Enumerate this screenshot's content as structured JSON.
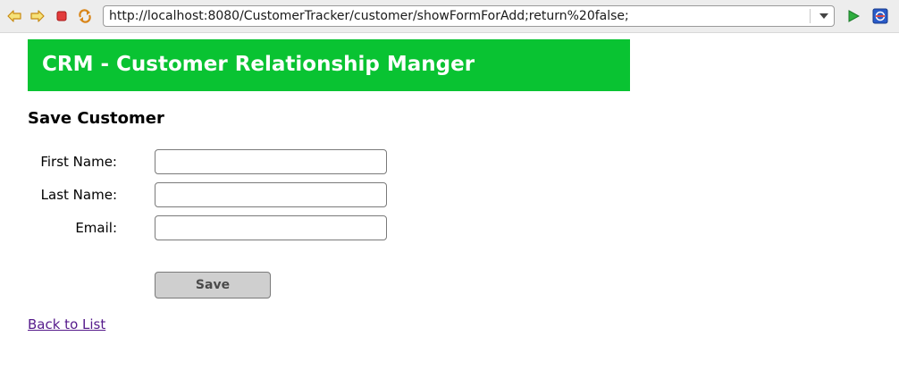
{
  "browser": {
    "url": "http://localhost:8080/CustomerTracker/customer/showFormForAdd;return%20false;",
    "icons": {
      "back": "arrow-left-icon",
      "forward": "arrow-right-icon",
      "stop": "stop-icon",
      "refresh": "refresh-icon",
      "dropdown": "chevron-down-icon",
      "go": "play-icon",
      "external": "external-browser-icon"
    }
  },
  "header": {
    "title": "CRM - Customer Relationship Manger",
    "color": "#09c332"
  },
  "form": {
    "title": "Save Customer",
    "fields": [
      {
        "label": "First Name:",
        "value": ""
      },
      {
        "label": "Last Name:",
        "value": ""
      },
      {
        "label": "Email:",
        "value": ""
      }
    ],
    "save_label": "Save"
  },
  "back_link": "Back to List"
}
